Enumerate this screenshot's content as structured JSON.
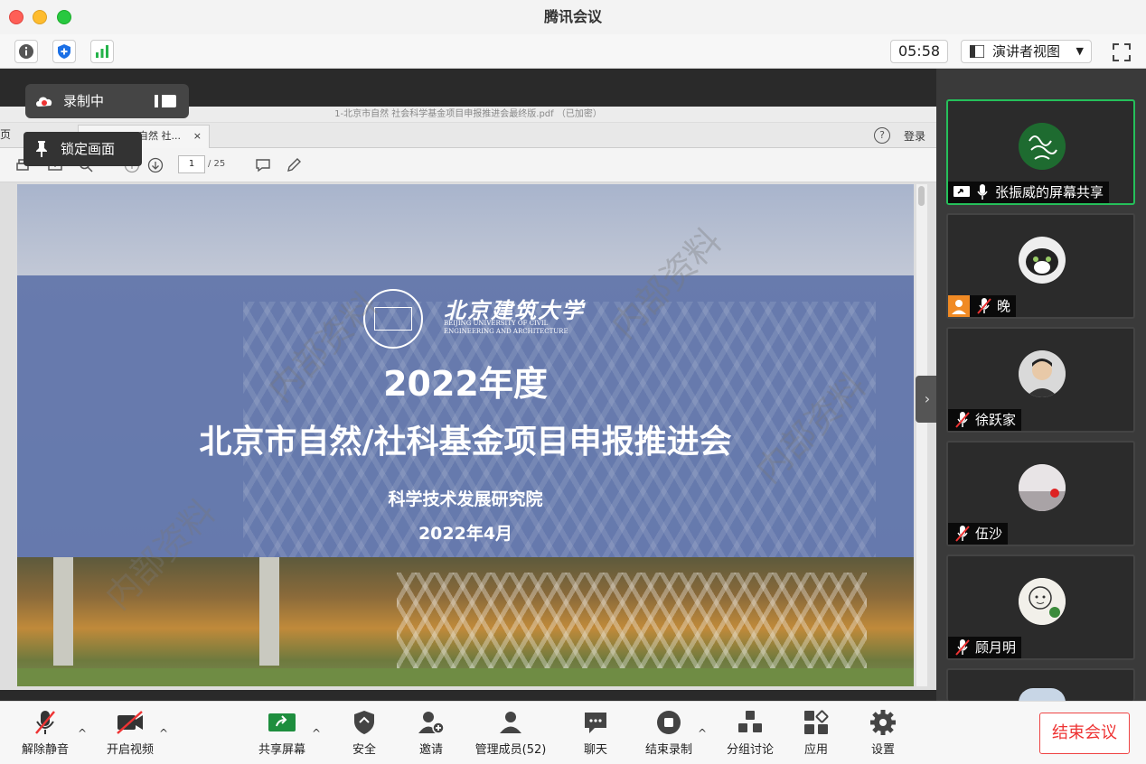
{
  "window": {
    "title": "腾讯会议"
  },
  "topbar": {
    "timer": "05:58",
    "view_label": "演讲者视图"
  },
  "recording": {
    "label": "录制中"
  },
  "lock": {
    "label": "锁定画面"
  },
  "pdf": {
    "window_title": "1-北京市自然 社会科学基金项目申报推进会最终版.pdf （已加密）",
    "tab_left": "页",
    "tab_label": "自然 社...",
    "login": "登录",
    "page_current": "1",
    "page_total": "/ 25"
  },
  "slide": {
    "logo_cn": "北京建筑大学",
    "logo_en": "BEIJING UNIVERSITY OF CIVIL ENGINEERING AND ARCHITECTURE",
    "year": "2022年度",
    "title": "北京市自然/社科基金项目申报推进会",
    "org": "科学技术发展研究院",
    "date": "2022年4月",
    "watermark": "内部资料"
  },
  "participants": [
    {
      "name": "张振威的屏幕共享"
    },
    {
      "name": "晚"
    },
    {
      "name": "徐跃家"
    },
    {
      "name": "伍沙"
    },
    {
      "name": "顾月明"
    }
  ],
  "bottombar": {
    "unmute": "解除静音",
    "video": "开启视频",
    "share": "共享屏幕",
    "security": "安全",
    "invite": "邀请",
    "members": "管理成员(52)",
    "chat": "聊天",
    "end_record": "结束录制",
    "breakout": "分组讨论",
    "apps": "应用",
    "settings": "设置",
    "end_meeting": "结束会议"
  },
  "colors": {
    "active_border": "#25c05a",
    "end_red": "#e33333"
  }
}
